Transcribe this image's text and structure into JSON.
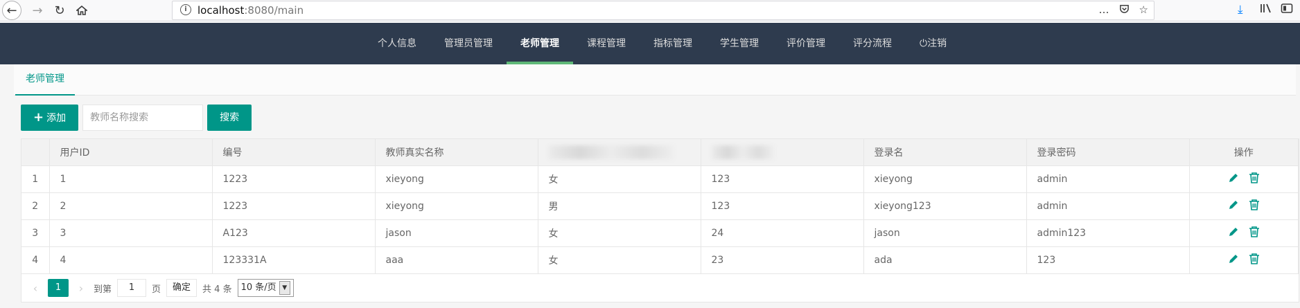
{
  "browser": {
    "url_host": "localhost",
    "url_rest": ":8080/main",
    "more_icon": "…",
    "pocket_icon": "pocket-icon",
    "star_icon": "star-icon"
  },
  "nav": {
    "items": [
      "个人信息",
      "管理员管理",
      "老师管理",
      "课程管理",
      "指标管理",
      "学生管理",
      "评价管理",
      "评分流程",
      "注销"
    ],
    "active": "老师管理"
  },
  "tab": {
    "label": "老师管理"
  },
  "toolbar": {
    "add_label": "添加",
    "search_placeholder": "教师名称搜索",
    "search_label": "搜索"
  },
  "table": {
    "headers": [
      "用户ID",
      "编号",
      "教师真实名称",
      "",
      "",
      "登录名",
      "登录密码",
      "操作"
    ],
    "rows": [
      {
        "idx": "1",
        "cells": [
          "1",
          "1223",
          "xieyong",
          "女",
          "123",
          "xieyong",
          "admin"
        ]
      },
      {
        "idx": "2",
        "cells": [
          "2",
          "1223",
          "xieyong",
          "男",
          "123",
          "xieyong123",
          "admin"
        ]
      },
      {
        "idx": "3",
        "cells": [
          "3",
          "A123",
          "jason",
          "女",
          "24",
          "jason",
          "admin123"
        ]
      },
      {
        "idx": "4",
        "cells": [
          "4",
          "123331A",
          "aaa",
          "女",
          "23",
          "ada",
          "123"
        ]
      }
    ]
  },
  "pager": {
    "current": "1",
    "goto_label": "到第",
    "goto_value": "1",
    "page_unit": "页",
    "confirm": "确定",
    "total": "共 4 条",
    "page_size": "10 条/页"
  },
  "colors": {
    "accent": "#009688",
    "header_bg": "#2e3b4e",
    "active_bar": "#5fb878"
  }
}
